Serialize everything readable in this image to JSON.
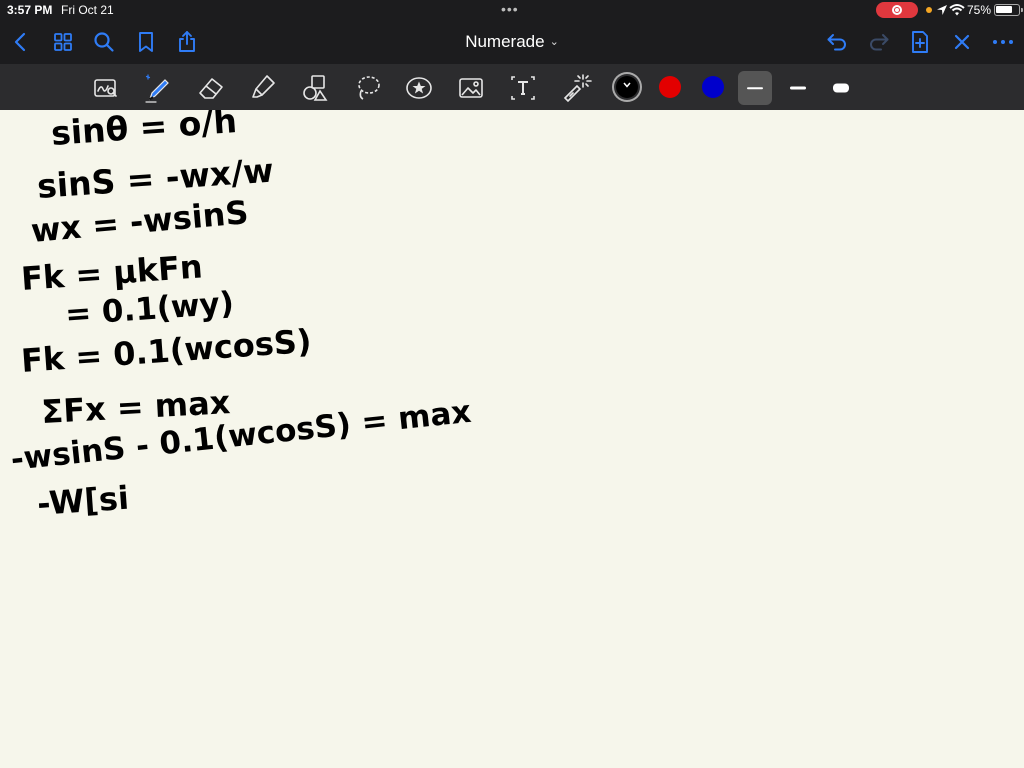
{
  "status_bar": {
    "time": "3:57 PM",
    "date": "Fri Oct 21",
    "more_dots": "•••",
    "battery_percent": "75%",
    "battery_level": 0.75,
    "icons": [
      "screen-recording-icon",
      "location-icon",
      "wifi-icon",
      "battery-icon"
    ]
  },
  "nav": {
    "title": "Numerade",
    "title_chevron": "⌄",
    "left_icons": [
      "back-icon",
      "grid-icon",
      "search-icon",
      "bookmark-icon",
      "share-icon"
    ],
    "right_icons": [
      "undo-icon",
      "redo-icon",
      "add-page-icon",
      "close-icon",
      "more-icon"
    ]
  },
  "toolbar": {
    "tools": [
      "lasso-zoom-icon",
      "pen-icon",
      "eraser-icon",
      "highlighter-icon",
      "shapes-icon",
      "lasso-icon",
      "sticker-icon",
      "image-icon",
      "text-icon",
      "laser-pointer-icon"
    ],
    "active_tool": "pen",
    "colors": [
      {
        "name": "black",
        "hex": "#000000",
        "selected": true
      },
      {
        "name": "red",
        "hex": "#e30000",
        "selected": false
      },
      {
        "name": "blue",
        "hex": "#0000cc",
        "selected": false
      }
    ],
    "stroke_widths": [
      "thin",
      "medium",
      "thick"
    ],
    "selected_stroke": "thin"
  },
  "canvas": {
    "background": "#f6f6eb",
    "ink_color": "#000000",
    "handwritten_lines": [
      "sinθ = o/h",
      "sinS = -wx/w",
      "wx = -wsinS",
      "Fk = μkFn",
      "= 0.1(wy)",
      "Fk = 0.1(wcosS)",
      "ΣFx = max",
      "-wsinS - 0.1(wcosS) = max",
      "-W[si"
    ]
  }
}
